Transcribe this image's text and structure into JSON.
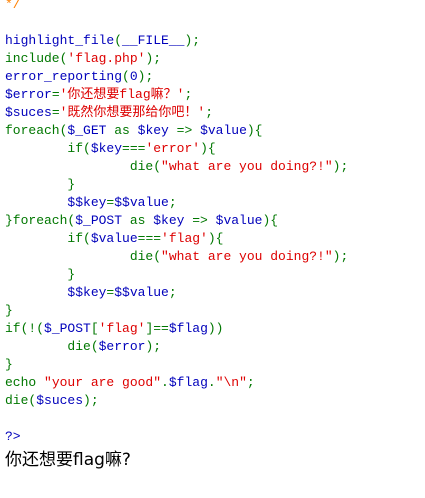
{
  "colors": {
    "default": "#0000bb",
    "keyword": "#007700",
    "string": "#dd0000",
    "comment": "#ff8000",
    "html": "#000000"
  },
  "source_lines": [
    [
      {
        "t": "comment",
        "v": "*/"
      }
    ],
    [
      {
        "t": "default",
        "v": ""
      }
    ],
    [
      {
        "t": "default",
        "v": "highlight_file"
      },
      {
        "t": "keyword",
        "v": "("
      },
      {
        "t": "default",
        "v": "__FILE__"
      },
      {
        "t": "keyword",
        "v": ");"
      }
    ],
    [
      {
        "t": "keyword",
        "v": "include("
      },
      {
        "t": "string",
        "v": "'flag.php'"
      },
      {
        "t": "keyword",
        "v": ");"
      }
    ],
    [
      {
        "t": "default",
        "v": "error_reporting"
      },
      {
        "t": "keyword",
        "v": "("
      },
      {
        "t": "default",
        "v": "0"
      },
      {
        "t": "keyword",
        "v": ");"
      }
    ],
    [
      {
        "t": "default",
        "v": "$error"
      },
      {
        "t": "keyword",
        "v": "="
      },
      {
        "t": "string",
        "v": "'你还想要flag嘛？'"
      },
      {
        "t": "keyword",
        "v": ";"
      }
    ],
    [
      {
        "t": "default",
        "v": "$suces"
      },
      {
        "t": "keyword",
        "v": "="
      },
      {
        "t": "string",
        "v": "'既然你想要那给你吧！'"
      },
      {
        "t": "keyword",
        "v": ";"
      }
    ],
    [
      {
        "t": "keyword",
        "v": "foreach("
      },
      {
        "t": "default",
        "v": "$_GET "
      },
      {
        "t": "keyword",
        "v": "as "
      },
      {
        "t": "default",
        "v": "$key "
      },
      {
        "t": "keyword",
        "v": "=> "
      },
      {
        "t": "default",
        "v": "$value"
      },
      {
        "t": "keyword",
        "v": "){"
      }
    ],
    [
      {
        "t": "keyword",
        "v": "        if("
      },
      {
        "t": "default",
        "v": "$key"
      },
      {
        "t": "keyword",
        "v": "==="
      },
      {
        "t": "string",
        "v": "'error'"
      },
      {
        "t": "keyword",
        "v": "){"
      }
    ],
    [
      {
        "t": "keyword",
        "v": "                die("
      },
      {
        "t": "string",
        "v": "\"what are you doing?!\""
      },
      {
        "t": "keyword",
        "v": ");"
      }
    ],
    [
      {
        "t": "keyword",
        "v": "        }"
      }
    ],
    [
      {
        "t": "default",
        "v": "        $$key"
      },
      {
        "t": "keyword",
        "v": "="
      },
      {
        "t": "default",
        "v": "$$value"
      },
      {
        "t": "keyword",
        "v": ";"
      }
    ],
    [
      {
        "t": "keyword",
        "v": "}foreach("
      },
      {
        "t": "default",
        "v": "$_POST "
      },
      {
        "t": "keyword",
        "v": "as "
      },
      {
        "t": "default",
        "v": "$key "
      },
      {
        "t": "keyword",
        "v": "=> "
      },
      {
        "t": "default",
        "v": "$value"
      },
      {
        "t": "keyword",
        "v": "){"
      }
    ],
    [
      {
        "t": "keyword",
        "v": "        if("
      },
      {
        "t": "default",
        "v": "$value"
      },
      {
        "t": "keyword",
        "v": "==="
      },
      {
        "t": "string",
        "v": "'flag'"
      },
      {
        "t": "keyword",
        "v": "){"
      }
    ],
    [
      {
        "t": "keyword",
        "v": "                die("
      },
      {
        "t": "string",
        "v": "\"what are you doing?!\""
      },
      {
        "t": "keyword",
        "v": ");"
      }
    ],
    [
      {
        "t": "keyword",
        "v": "        }"
      }
    ],
    [
      {
        "t": "default",
        "v": "        $$key"
      },
      {
        "t": "keyword",
        "v": "="
      },
      {
        "t": "default",
        "v": "$$value"
      },
      {
        "t": "keyword",
        "v": ";"
      }
    ],
    [
      {
        "t": "keyword",
        "v": "}"
      }
    ],
    [
      {
        "t": "keyword",
        "v": "if(!("
      },
      {
        "t": "default",
        "v": "$_POST"
      },
      {
        "t": "keyword",
        "v": "["
      },
      {
        "t": "string",
        "v": "'flag'"
      },
      {
        "t": "keyword",
        "v": "]=="
      },
      {
        "t": "default",
        "v": "$flag"
      },
      {
        "t": "keyword",
        "v": "))"
      }
    ],
    [
      {
        "t": "keyword",
        "v": "        die("
      },
      {
        "t": "default",
        "v": "$error"
      },
      {
        "t": "keyword",
        "v": ");"
      }
    ],
    [
      {
        "t": "keyword",
        "v": "}"
      }
    ],
    [
      {
        "t": "keyword",
        "v": "echo "
      },
      {
        "t": "string",
        "v": "\"your are good\""
      },
      {
        "t": "keyword",
        "v": "."
      },
      {
        "t": "default",
        "v": "$flag"
      },
      {
        "t": "keyword",
        "v": "."
      },
      {
        "t": "string",
        "v": "\"\\n\""
      },
      {
        "t": "keyword",
        "v": ";"
      }
    ],
    [
      {
        "t": "keyword",
        "v": "die("
      },
      {
        "t": "default",
        "v": "$suces"
      },
      {
        "t": "keyword",
        "v": ");"
      }
    ],
    [
      {
        "t": "default",
        "v": ""
      }
    ],
    [
      {
        "t": "default",
        "v": "?>"
      }
    ]
  ],
  "output_text": "你还想要flag嘛?"
}
